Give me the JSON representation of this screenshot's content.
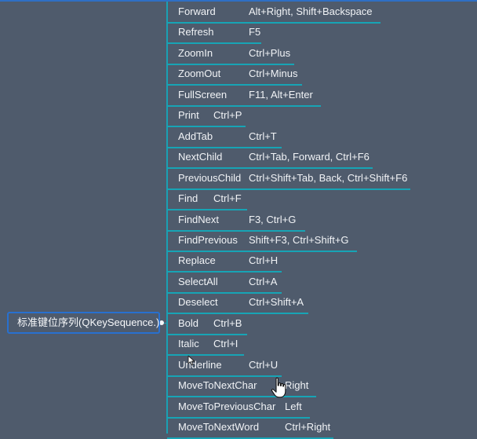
{
  "root": {
    "label": "标准键位序列(QKeySequence.)"
  },
  "items": [
    {
      "name": "Forward",
      "keys": "Alt+Right, Shift+Backspace"
    },
    {
      "name": "Refresh",
      "keys": "F5"
    },
    {
      "name": "ZoomIn",
      "keys": "Ctrl+Plus"
    },
    {
      "name": "ZoomOut",
      "keys": "Ctrl+Minus"
    },
    {
      "name": "FullScreen",
      "keys": "F11, Alt+Enter"
    },
    {
      "name": "Print",
      "keys": "Ctrl+P"
    },
    {
      "name": "AddTab",
      "keys": "Ctrl+T"
    },
    {
      "name": "NextChild",
      "keys": "Ctrl+Tab, Forward, Ctrl+F6"
    },
    {
      "name": "PreviousChild",
      "keys": "Ctrl+Shift+Tab, Back, Ctrl+Shift+F6"
    },
    {
      "name": "Find",
      "keys": "Ctrl+F"
    },
    {
      "name": "FindNext",
      "keys": "F3, Ctrl+G"
    },
    {
      "name": "FindPrevious",
      "keys": "Shift+F3, Ctrl+Shift+G"
    },
    {
      "name": "Replace",
      "keys": "Ctrl+H"
    },
    {
      "name": "SelectAll",
      "keys": "Ctrl+A"
    },
    {
      "name": "Deselect",
      "keys": "Ctrl+Shift+A"
    },
    {
      "name": "Bold",
      "keys": "Ctrl+B"
    },
    {
      "name": "Italic",
      "keys": "Ctrl+I"
    },
    {
      "name": "Underline",
      "keys": "Ctrl+U"
    },
    {
      "name": "MoveToNextChar",
      "keys": "Right"
    },
    {
      "name": "MoveToPreviousChar",
      "keys": "Left"
    },
    {
      "name": "MoveToNextWord",
      "keys": "Ctrl+Right"
    }
  ]
}
